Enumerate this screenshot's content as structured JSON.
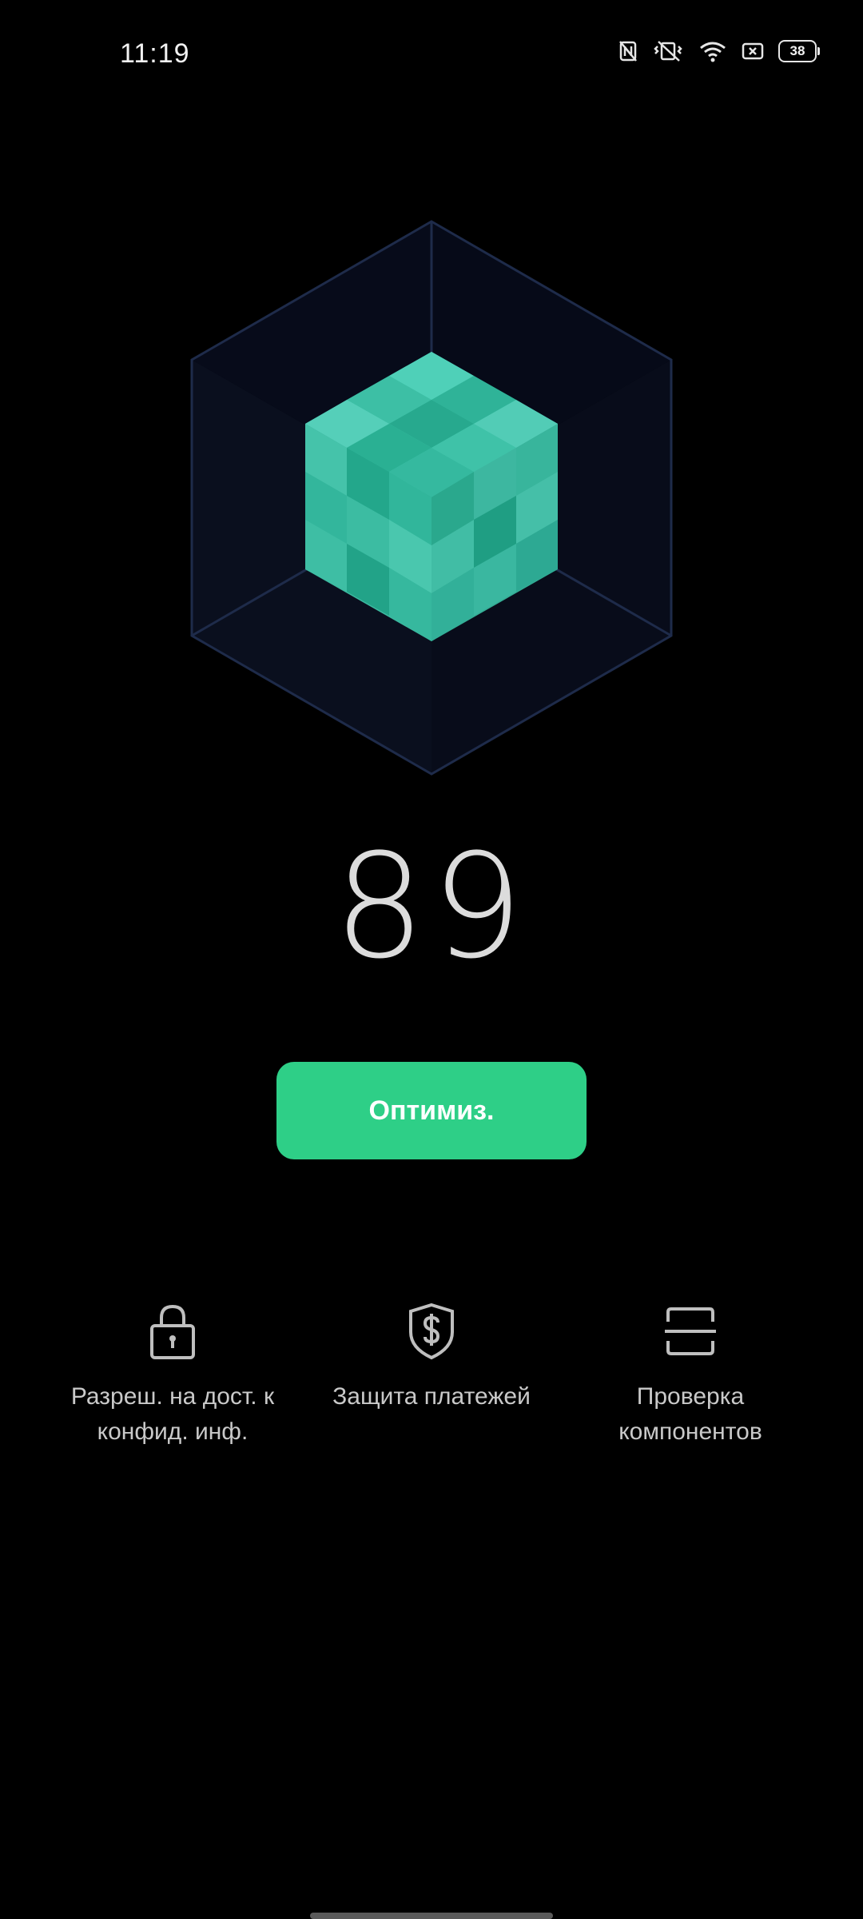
{
  "status_bar": {
    "time": "11:19",
    "icons": [
      "nfc-icon",
      "vibrate-mute-icon",
      "wifi-icon",
      "sim-icon",
      "battery-icon"
    ],
    "battery_level": "38"
  },
  "main": {
    "score": "89",
    "optimize_button": "Оптимиз.",
    "tools": [
      {
        "icon": "lock-icon",
        "label": "Разреш. на дост. к\nконфид. инф."
      },
      {
        "icon": "shield-dollar-icon",
        "label": "Защита платежей"
      },
      {
        "icon": "scan-icon",
        "label": "Проверка\nкомпонентов"
      }
    ]
  },
  "colors": {
    "background": "#000000",
    "accent": "#2ecf87",
    "cube": "#3ec2a7",
    "frame": "#1e2b4a"
  }
}
